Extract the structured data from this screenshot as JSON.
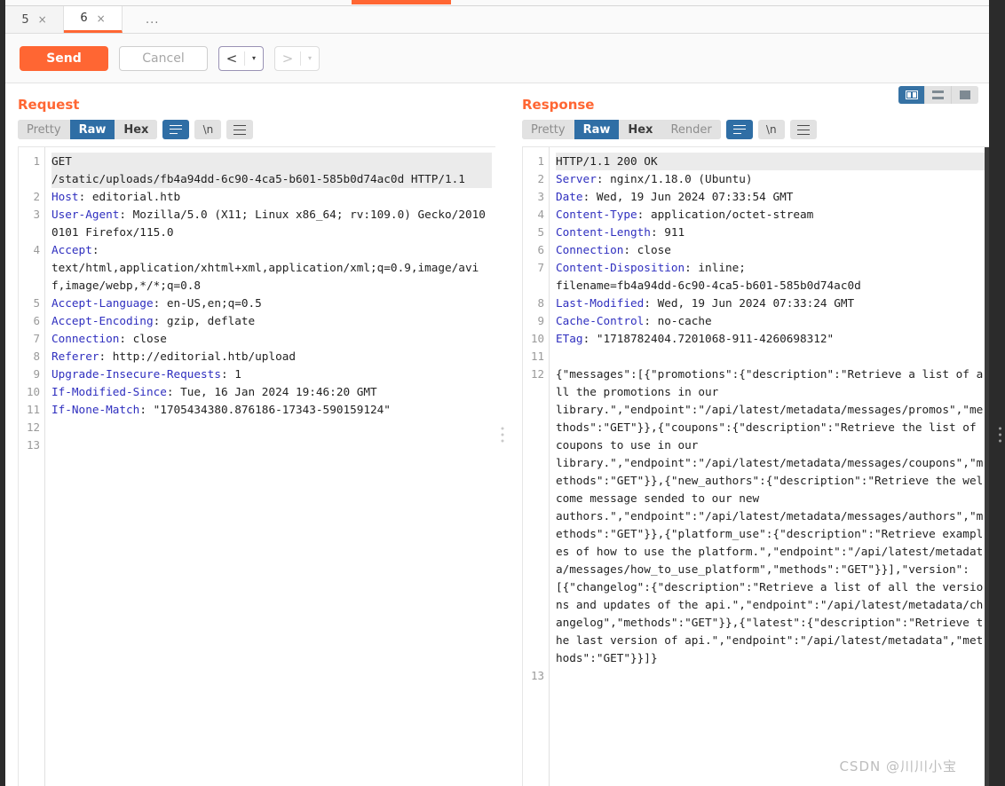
{
  "window": {
    "tabs": [
      {
        "label": "5",
        "close": "×",
        "active": false
      },
      {
        "label": "6",
        "close": "×",
        "active": true
      }
    ],
    "overflow_label": "...",
    "accent_color": "#ff6633"
  },
  "actions": {
    "send_label": "Send",
    "cancel_label": "Cancel",
    "prev_arrow": "<",
    "next_arrow": ">",
    "caret": "▾"
  },
  "request": {
    "title": "Request",
    "tabs": [
      {
        "label": "Pretty",
        "state": "inactive"
      },
      {
        "label": "Raw",
        "state": "active"
      },
      {
        "label": "Hex",
        "state": "dark"
      }
    ],
    "wrap_icon": "wrap-lines-icon",
    "newline_label": "\\n",
    "menu_icon": "hamburger-icon",
    "line_numbers": [
      "1",
      "2",
      "3",
      "4",
      "5",
      "6",
      "7",
      "8",
      "9",
      "10",
      "11",
      "12",
      "13"
    ],
    "lines": [
      {
        "n": "1",
        "highlight": true,
        "parts": [
          {
            "t": "GET\n/static/uploads/fb4a94dd-6c90-4ca5-b601-585b0d74ac0d HTTP/1.1",
            "k": "plain"
          }
        ]
      },
      {
        "n": "2",
        "highlight": false,
        "parts": [
          {
            "t": "Host",
            "k": "hdr"
          },
          {
            "t": ": editorial.htb",
            "k": "plain"
          }
        ]
      },
      {
        "n": "3",
        "highlight": false,
        "parts": [
          {
            "t": "User-Agent",
            "k": "hdr"
          },
          {
            "t": ": Mozilla/5.0 (X11; Linux x86_64; rv:109.0) Gecko/20100101 Firefox/115.0",
            "k": "plain"
          }
        ]
      },
      {
        "n": "4",
        "highlight": false,
        "parts": [
          {
            "t": "Accept",
            "k": "hdr"
          },
          {
            "t": ":\ntext/html,application/xhtml+xml,application/xml;q=0.9,image/avif,image/webp,*/*;q=0.8",
            "k": "plain"
          }
        ]
      },
      {
        "n": "5",
        "highlight": false,
        "parts": [
          {
            "t": "Accept-Language",
            "k": "hdr"
          },
          {
            "t": ": en-US,en;q=0.5",
            "k": "plain"
          }
        ]
      },
      {
        "n": "6",
        "highlight": false,
        "parts": [
          {
            "t": "Accept-Encoding",
            "k": "hdr"
          },
          {
            "t": ": gzip, deflate",
            "k": "plain"
          }
        ]
      },
      {
        "n": "7",
        "highlight": false,
        "parts": [
          {
            "t": "Connection",
            "k": "hdr"
          },
          {
            "t": ": close",
            "k": "plain"
          }
        ]
      },
      {
        "n": "8",
        "highlight": false,
        "parts": [
          {
            "t": "Referer",
            "k": "hdr"
          },
          {
            "t": ": http://editorial.htb/upload",
            "k": "plain"
          }
        ]
      },
      {
        "n": "9",
        "highlight": false,
        "parts": [
          {
            "t": "Upgrade-Insecure-Requests",
            "k": "hdr"
          },
          {
            "t": ": 1",
            "k": "plain"
          }
        ]
      },
      {
        "n": "10",
        "highlight": false,
        "parts": [
          {
            "t": "If-Modified-Since",
            "k": "hdr"
          },
          {
            "t": ": Tue, 16 Jan 2024 19:46:20 GMT",
            "k": "plain"
          }
        ]
      },
      {
        "n": "11",
        "highlight": false,
        "parts": [
          {
            "t": "If-None-Match",
            "k": "hdr"
          },
          {
            "t": ": \"1705434380.876186-17343-590159124\"",
            "k": "plain"
          }
        ]
      },
      {
        "n": "12",
        "highlight": false,
        "parts": [
          {
            "t": "",
            "k": "plain"
          }
        ]
      },
      {
        "n": "13",
        "highlight": false,
        "parts": [
          {
            "t": "",
            "k": "plain"
          }
        ]
      }
    ]
  },
  "response": {
    "title": "Response",
    "tabs": [
      {
        "label": "Pretty",
        "state": "inactive"
      },
      {
        "label": "Raw",
        "state": "active"
      },
      {
        "label": "Hex",
        "state": "dark"
      },
      {
        "label": "Render",
        "state": "inactive"
      }
    ],
    "wrap_icon": "wrap-lines-icon",
    "newline_label": "\\n",
    "menu_icon": "hamburger-icon",
    "view_modes": [
      {
        "name": "split-vertical-view",
        "active": true
      },
      {
        "name": "stacked-horizontal-view",
        "active": false
      },
      {
        "name": "single-view",
        "active": false
      }
    ],
    "lines": [
      {
        "n": "1",
        "highlight": true,
        "parts": [
          {
            "t": "HTTP/1.1 200 OK",
            "k": "plain"
          }
        ]
      },
      {
        "n": "2",
        "highlight": false,
        "parts": [
          {
            "t": "Server",
            "k": "hdr"
          },
          {
            "t": ": nginx/1.18.0 (Ubuntu)",
            "k": "plain"
          }
        ]
      },
      {
        "n": "3",
        "highlight": false,
        "parts": [
          {
            "t": "Date",
            "k": "hdr"
          },
          {
            "t": ": Wed, 19 Jun 2024 07:33:54 GMT",
            "k": "plain"
          }
        ]
      },
      {
        "n": "4",
        "highlight": false,
        "parts": [
          {
            "t": "Content-Type",
            "k": "hdr"
          },
          {
            "t": ": application/octet-stream",
            "k": "plain"
          }
        ]
      },
      {
        "n": "5",
        "highlight": false,
        "parts": [
          {
            "t": "Content-Length",
            "k": "hdr"
          },
          {
            "t": ": 911",
            "k": "plain"
          }
        ]
      },
      {
        "n": "6",
        "highlight": false,
        "parts": [
          {
            "t": "Connection",
            "k": "hdr"
          },
          {
            "t": ": close",
            "k": "plain"
          }
        ]
      },
      {
        "n": "7",
        "highlight": false,
        "parts": [
          {
            "t": "Content-Disposition",
            "k": "hdr"
          },
          {
            "t": ": inline;\nfilename=fb4a94dd-6c90-4ca5-b601-585b0d74ac0d",
            "k": "plain"
          }
        ]
      },
      {
        "n": "8",
        "highlight": false,
        "parts": [
          {
            "t": "Last-Modified",
            "k": "hdr"
          },
          {
            "t": ": Wed, 19 Jun 2024 07:33:24 GMT",
            "k": "plain"
          }
        ]
      },
      {
        "n": "9",
        "highlight": false,
        "parts": [
          {
            "t": "Cache-Control",
            "k": "hdr"
          },
          {
            "t": ": no-cache",
            "k": "plain"
          }
        ]
      },
      {
        "n": "10",
        "highlight": false,
        "parts": [
          {
            "t": "ETag",
            "k": "hdr"
          },
          {
            "t": ": \"1718782404.7201068-911-4260698312\"",
            "k": "plain"
          }
        ]
      },
      {
        "n": "11",
        "highlight": false,
        "parts": [
          {
            "t": "",
            "k": "plain"
          }
        ]
      },
      {
        "n": "12",
        "highlight": false,
        "parts": [
          {
            "t": "{\"messages\":[{\"promotions\":{\"description\":\"Retrieve a list of all the promotions in our\nlibrary.\",\"endpoint\":\"/api/latest/metadata/messages/promos\",\"methods\":\"GET\"}},{\"coupons\":{\"description\":\"Retrieve the list of coupons to use in our\nlibrary.\",\"endpoint\":\"/api/latest/metadata/messages/coupons\",\"methods\":\"GET\"}},{\"new_authors\":{\"description\":\"Retrieve the welcome message sended to our new\nauthors.\",\"endpoint\":\"/api/latest/metadata/messages/authors\",\"methods\":\"GET\"}},{\"platform_use\":{\"description\":\"Retrieve examples of how to use the platform.\",\"endpoint\":\"/api/latest/metadata/messages/how_to_use_platform\",\"methods\":\"GET\"}}],\"version\":[{\"changelog\":{\"description\":\"Retrieve a list of all the versions and updates of the api.\",\"endpoint\":\"/api/latest/metadata/changelog\",\"methods\":\"GET\"}},{\"latest\":{\"description\":\"Retrieve the last version of api.\",\"endpoint\":\"/api/latest/metadata\",\"methods\":\"GET\"}}]}",
            "k": "plain"
          }
        ]
      },
      {
        "n": "13",
        "highlight": false,
        "parts": [
          {
            "t": "",
            "k": "plain"
          }
        ]
      }
    ]
  },
  "watermark": "CSDN @川川小宝"
}
